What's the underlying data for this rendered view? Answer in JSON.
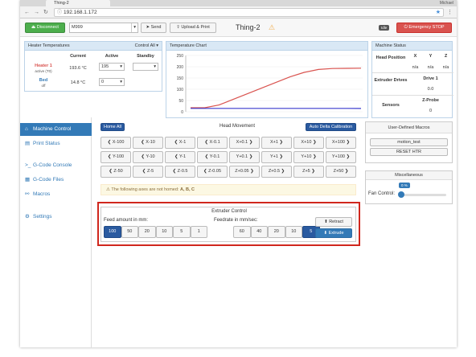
{
  "browser": {
    "tab_title": "Thing-2",
    "user": "Michael",
    "url": "192.168.1.172"
  },
  "topbar": {
    "disconnect": "Disconnect",
    "gcode_value": "M999",
    "send": "Send",
    "upload": "Upload & Print",
    "machine_name": "Thing-2",
    "status_badge": "Idle",
    "emergency": "Emergency STOP"
  },
  "heater": {
    "title": "Heater Temperatures",
    "control_all": "Control All",
    "cols": [
      "Current",
      "Active",
      "Standby"
    ],
    "rows": [
      {
        "name": "Heater 1",
        "sub": "active (T0)",
        "current": "193.6 °C",
        "active": "195",
        "standby": ""
      },
      {
        "name": "Bed",
        "sub": "off",
        "current": "14.8 °C",
        "active": "0",
        "standby": ""
      }
    ]
  },
  "chart": {
    "title": "Temperature Chart",
    "yticks": [
      "250",
      "200",
      "150",
      "100",
      "50",
      "0"
    ]
  },
  "chart_data": {
    "type": "line",
    "ylim": [
      0,
      250
    ],
    "yticks": [
      0,
      50,
      100,
      150,
      200,
      250
    ],
    "series": [
      {
        "color": "#d9534f",
        "values": [
          18,
          18,
          30,
          55,
          80,
          105,
          130,
          155,
          175,
          188,
          192,
          193,
          193.6
        ]
      },
      {
        "color": "#3a3acd",
        "values": [
          15,
          15,
          15,
          15,
          15,
          15,
          15,
          15,
          15,
          15,
          15,
          15,
          14.8
        ]
      }
    ]
  },
  "status": {
    "title": "Machine Status",
    "head_position": "Head Position",
    "cols": [
      "X",
      "Y",
      "Z"
    ],
    "vals": [
      "n/a",
      "n/a",
      "n/a"
    ],
    "extruder_drives": "Extruder Drives",
    "drive1": "Drive 1",
    "drive1_val": "0.0",
    "sensors": "Sensors",
    "zprobe": "Z-Probe",
    "zprobe_val": "0"
  },
  "sidebar": {
    "items": [
      {
        "icon": "⌂",
        "label": "Machine Control"
      },
      {
        "icon": "▤",
        "label": "Print Status"
      },
      {
        "icon": ">_",
        "label": "G-Code Console"
      },
      {
        "icon": "▦",
        "label": "G-Code Files"
      },
      {
        "icon": "⚯",
        "label": "Macros"
      },
      {
        "icon": "⚙",
        "label": "Settings"
      }
    ]
  },
  "head": {
    "home_all": "Home All",
    "title": "Head Movement",
    "auto_delta": "Auto Delta Calibration",
    "rows": [
      [
        "X-100",
        "X-10",
        "X-1",
        "X-0.1",
        "X+0.1",
        "X+1",
        "X+10",
        "X+100"
      ],
      [
        "Y-100",
        "Y-10",
        "Y-1",
        "Y-0.1",
        "Y+0.1",
        "Y+1",
        "Y+10",
        "Y+100"
      ],
      [
        "Z-50",
        "Z-5",
        "Z-0.5",
        "Z-0.05",
        "Z+0.05",
        "Z+0.5",
        "Z+5",
        "Z+50"
      ]
    ],
    "warning_prefix": "The following axes are not homed:",
    "warning_axes": "A, B, C"
  },
  "extruder": {
    "title": "Extruder Control",
    "feed_label": "Feed amount in mm:",
    "feed": [
      "100",
      "50",
      "20",
      "10",
      "5",
      "1"
    ],
    "feed_selected": "100",
    "rate_label": "Feedrate in mm/sec:",
    "rate": [
      "60",
      "40",
      "20",
      "10",
      "5"
    ],
    "rate_selected": "5",
    "retract": "Retract",
    "extrude": "Extrude"
  },
  "macros": {
    "title": "User-Defined Macros",
    "items": [
      "motion_test",
      "RESET HTR"
    ]
  },
  "misc": {
    "title": "Miscellaneous",
    "fan_label": "Fan Control:",
    "fan_value": "0 %",
    "fan_level": 0
  }
}
